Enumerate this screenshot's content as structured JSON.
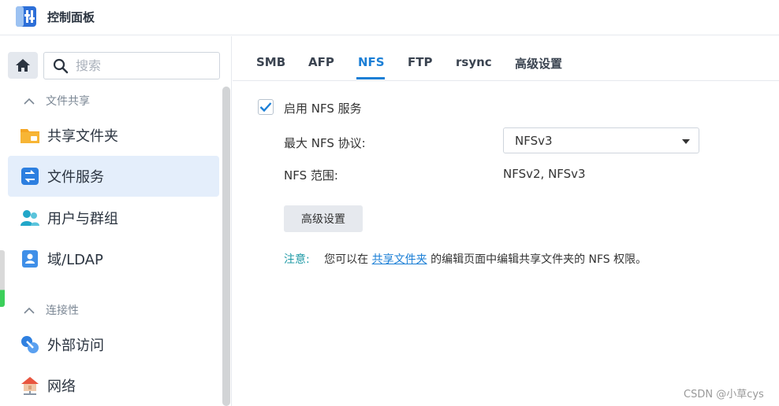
{
  "window": {
    "title": "控制面板"
  },
  "search": {
    "placeholder": "搜索"
  },
  "sidebar": {
    "groups": [
      {
        "label": "文件共享"
      },
      {
        "label": "连接性"
      }
    ],
    "items": [
      {
        "label": "共享文件夹",
        "icon": "folder-icon"
      },
      {
        "label": "文件服务",
        "icon": "file-services-icon",
        "active": true
      },
      {
        "label": "用户与群组",
        "icon": "users-icon"
      },
      {
        "label": "域/LDAP",
        "icon": "domain-icon"
      },
      {
        "label": "外部访问",
        "icon": "external-access-icon"
      },
      {
        "label": "网络",
        "icon": "network-icon"
      }
    ]
  },
  "tabs": [
    {
      "label": "SMB"
    },
    {
      "label": "AFP"
    },
    {
      "label": "NFS",
      "active": true
    },
    {
      "label": "FTP"
    },
    {
      "label": "rsync"
    },
    {
      "label": "高级设置"
    }
  ],
  "nfs": {
    "enable_label": "启用 NFS 服务",
    "enabled": true,
    "max_protocol_label": "最大 NFS 协议:",
    "max_protocol_value": "NFSv3",
    "range_label": "NFS 范围:",
    "range_value": "NFSv2, NFSv3",
    "advanced_button": "高级设置",
    "note_label": "注意:",
    "note_prefix": "您可以在",
    "note_link": "共享文件夹",
    "note_suffix": "的编辑页面中编辑共享文件夹的 NFS 权限。"
  },
  "watermark": "CSDN @小草cys",
  "colors": {
    "accent": "#1b7fd6",
    "note": "#1f9aa6",
    "active_bg": "#e4eefb"
  }
}
